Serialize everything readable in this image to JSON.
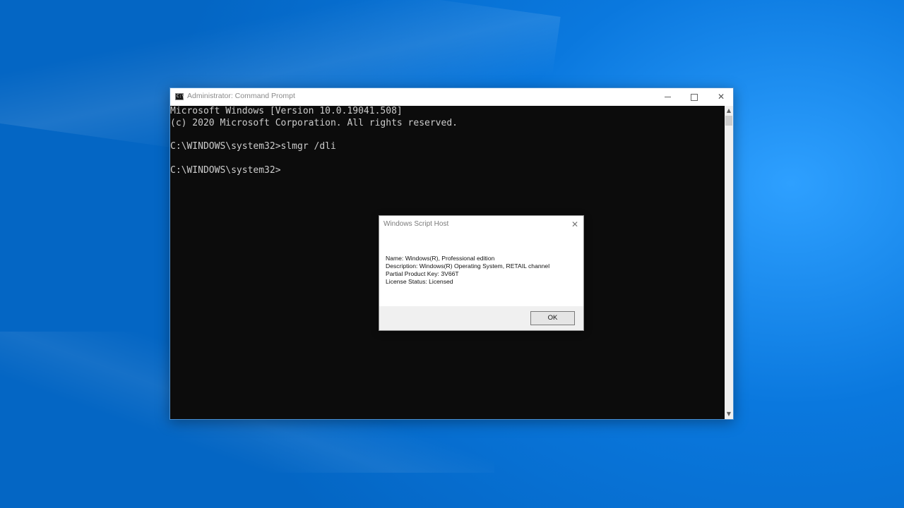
{
  "cmd_window": {
    "title": "Administrator: Command Prompt",
    "icon": "C:\\",
    "controls": {
      "minimize_icon": "minimize-icon",
      "maximize_icon": "maximize-icon",
      "close_glyph": "✕"
    },
    "lines": [
      "Microsoft Windows [Version 10.0.19041.508]",
      "(c) 2020 Microsoft Corporation. All rights reserved.",
      "",
      "C:\\WINDOWS\\system32>slmgr /dli",
      "",
      "C:\\WINDOWS\\system32>"
    ],
    "scrollbar": {
      "up_glyph": "▲",
      "down_glyph": "▼"
    }
  },
  "dialog": {
    "title": "Windows Script Host",
    "close_glyph": "✕",
    "lines": [
      "Name: Windows(R), Professional edition",
      "Description: Windows(R) Operating System, RETAIL channel",
      "Partial Product Key: 3V66T",
      "License Status: Licensed"
    ],
    "ok_label": "OK"
  },
  "colors": {
    "desktop_blue": "#0a74d8",
    "console_bg": "#0c0c0c",
    "console_text": "#cccccc"
  }
}
